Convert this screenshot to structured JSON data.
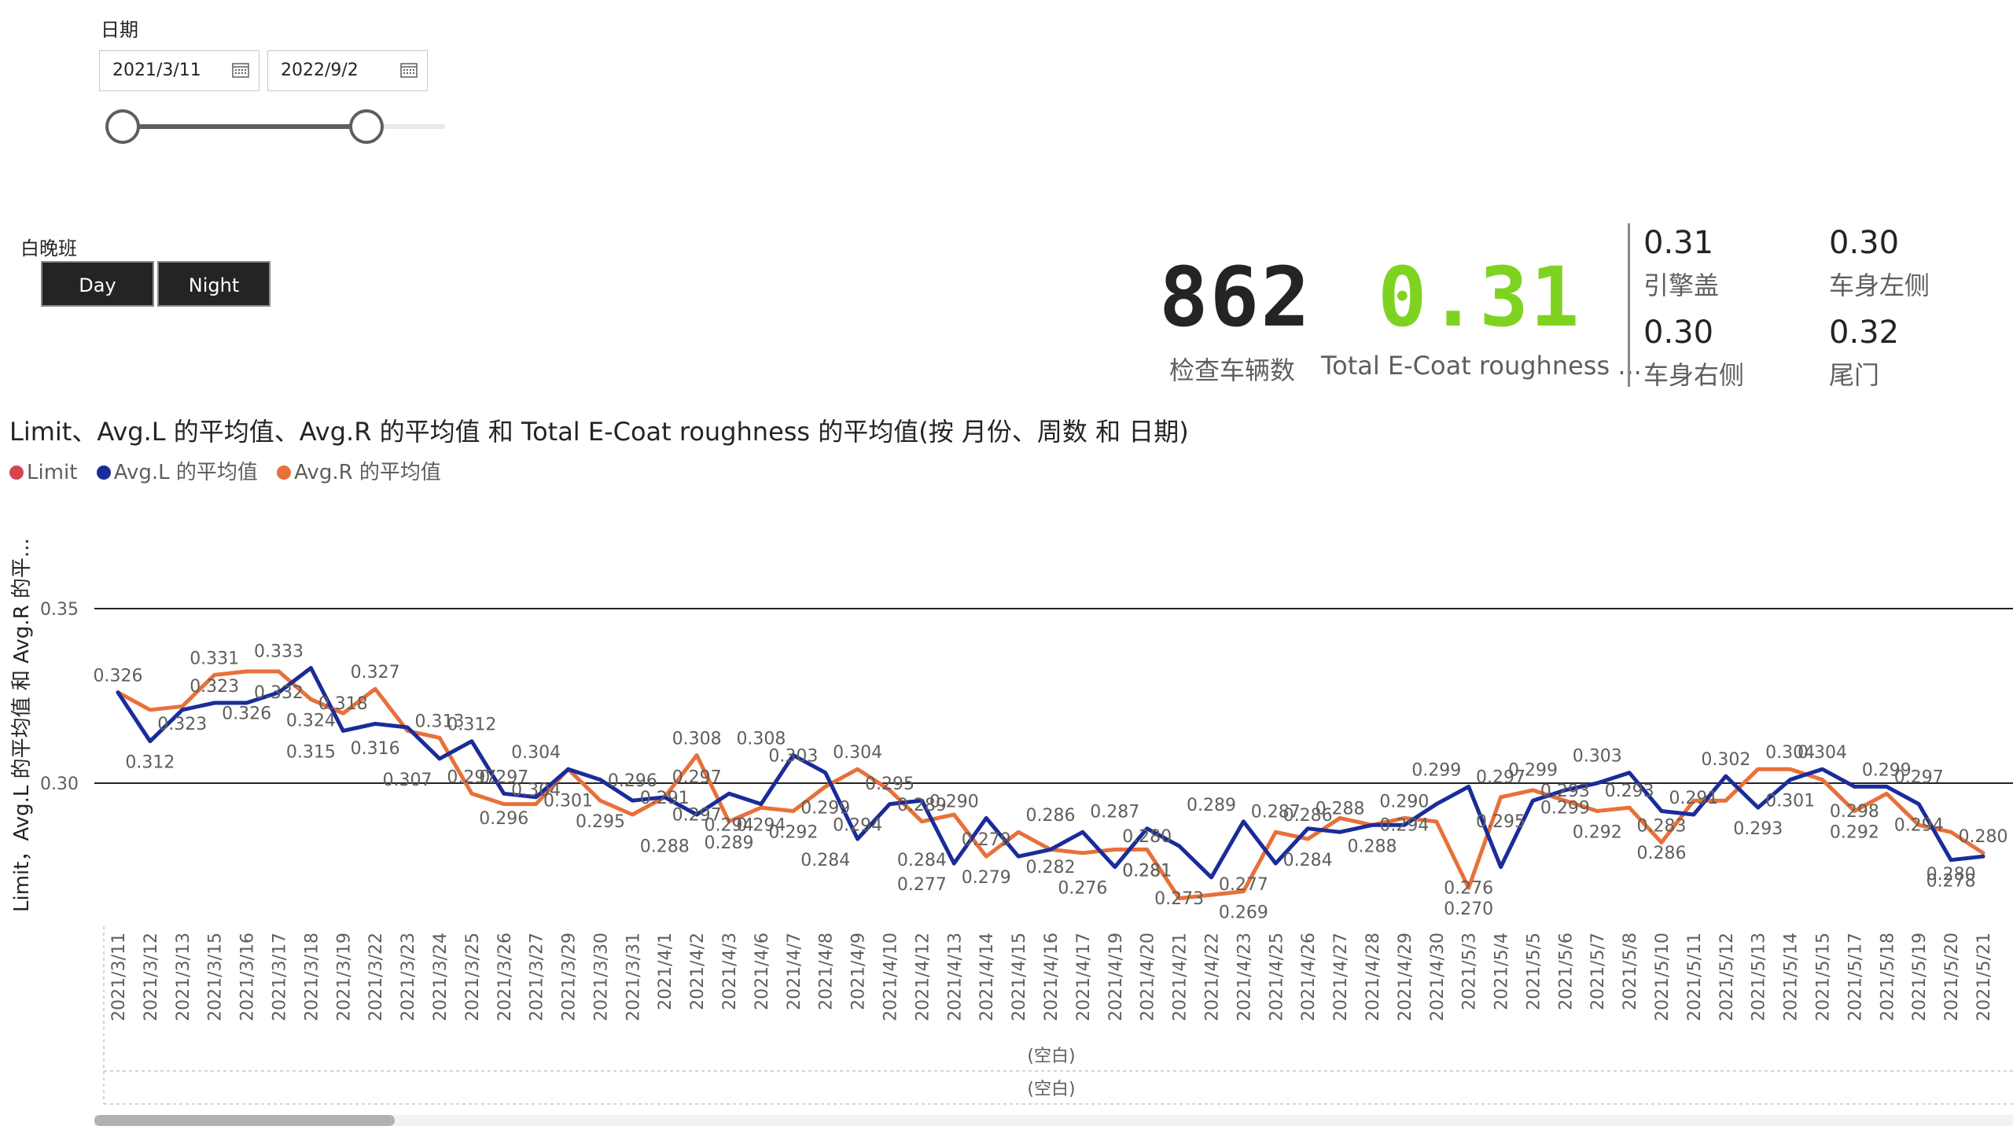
{
  "date_slicer": {
    "title": "日期",
    "start": "2021/3/11",
    "end": "2022/9/2",
    "icon": "calendar-icon"
  },
  "shift_slicer": {
    "title": "白晚班",
    "options": [
      "Day",
      "Night"
    ]
  },
  "kpis": {
    "vehicles_value": "862",
    "vehicles_label": "检查车辆数",
    "roughness_value": "0.31",
    "roughness_label": "Total E-Coat roughness ...",
    "roughness_color": "#7ed321",
    "parts": [
      {
        "value": "0.31",
        "label": "引擎盖"
      },
      {
        "value": "0.30",
        "label": "车身左侧"
      },
      {
        "value": "0.30",
        "label": "车身右侧"
      },
      {
        "value": "0.32",
        "label": "尾门"
      }
    ]
  },
  "chart_data": {
    "type": "line",
    "title": "Limit、Avg.L 的平均值、Avg.R 的平均值 和 Total E-Coat roughness 的平均值(按 月份、周数 和 日期)",
    "ylabel": "Limit，Avg.L 的平均值 和 Avg.R 的平...",
    "ylim": [
      0.24,
      0.37
    ],
    "yticks": [
      0.3,
      0.35
    ],
    "ytick_labels": [
      "0.30",
      "0.35"
    ],
    "gridlines": [
      0.3,
      0.35
    ],
    "group_labels": [
      "(空白)",
      "(空白)"
    ],
    "legend": [
      {
        "name": "Limit",
        "color": "#d64550"
      },
      {
        "name": "Avg.L 的平均值",
        "color": "#1a2c99"
      },
      {
        "name": "Avg.R 的平均值",
        "color": "#e8703a"
      }
    ],
    "categories": [
      "2021/3/11",
      "2021/3/12",
      "2021/3/13",
      "2021/3/15",
      "2021/3/16",
      "2021/3/17",
      "2021/3/18",
      "2021/3/19",
      "2021/3/22",
      "2021/3/23",
      "2021/3/24",
      "2021/3/25",
      "2021/3/26",
      "2021/3/27",
      "2021/3/29",
      "2021/3/30",
      "2021/3/31",
      "2021/4/1",
      "2021/4/2",
      "2021/4/3",
      "2021/4/6",
      "2021/4/7",
      "2021/4/8",
      "2021/4/9",
      "2021/4/10",
      "2021/4/12",
      "2021/4/13",
      "2021/4/14",
      "2021/4/15",
      "2021/4/16",
      "2021/4/17",
      "2021/4/19",
      "2021/4/20",
      "2021/4/21",
      "2021/4/22",
      "2021/4/23",
      "2021/4/25",
      "2021/4/26",
      "2021/4/27",
      "2021/4/28",
      "2021/4/29",
      "2021/4/30",
      "2021/5/3",
      "2021/5/4",
      "2021/5/5",
      "2021/5/6",
      "2021/5/7",
      "2021/5/8",
      "2021/5/10",
      "2021/5/11",
      "2021/5/12",
      "2021/5/13",
      "2021/5/14",
      "2021/5/15",
      "2021/5/17",
      "2021/5/18",
      "2021/5/19",
      "2021/5/20",
      "2021/5/21"
    ],
    "series": [
      {
        "name": "Avg.L 的平均值",
        "color": "#1a2c99",
        "values": [
          0.326,
          0.312,
          0.321,
          0.323,
          0.323,
          0.326,
          0.333,
          0.315,
          0.317,
          0.316,
          0.307,
          0.312,
          0.297,
          0.296,
          0.304,
          0.301,
          0.295,
          0.296,
          0.291,
          0.297,
          0.294,
          0.308,
          0.303,
          0.284,
          0.294,
          0.295,
          0.277,
          0.29,
          0.279,
          0.281,
          0.286,
          0.276,
          0.287,
          0.282,
          0.273,
          0.289,
          0.277,
          0.287,
          0.286,
          0.288,
          0.288,
          0.294,
          0.299,
          0.276,
          0.295,
          0.298,
          0.3,
          0.303,
          0.292,
          0.291,
          0.302,
          0.293,
          0.301,
          0.304,
          0.299,
          0.299,
          0.294,
          0.278,
          0.279
        ]
      },
      {
        "name": "Avg.R 的平均值",
        "color": "#e8703a",
        "values": [
          0.326,
          0.321,
          0.322,
          0.331,
          0.332,
          0.332,
          0.324,
          0.32,
          0.327,
          0.315,
          0.313,
          0.297,
          0.294,
          0.294,
          0.304,
          0.295,
          0.291,
          0.296,
          0.308,
          0.289,
          0.293,
          0.292,
          0.299,
          0.304,
          0.298,
          0.289,
          0.291,
          0.279,
          0.286,
          0.281,
          0.28,
          0.281,
          0.281,
          0.267,
          0.268,
          0.269,
          0.286,
          0.284,
          0.29,
          0.288,
          0.29,
          0.289,
          0.27,
          0.296,
          0.298,
          0.295,
          0.292,
          0.293,
          0.283,
          0.295,
          0.295,
          0.304,
          0.304,
          0.301,
          0.292,
          0.297,
          0.288,
          0.286,
          0.28
        ]
      }
    ],
    "data_labels": [
      {
        "text": "0.326",
        "i": 0,
        "v": 0.326,
        "pos": "above"
      },
      {
        "text": "0.312",
        "i": 1,
        "v": 0.312,
        "pos": "below"
      },
      {
        "text": "0.323",
        "i": 2,
        "v": 0.323,
        "pos": "below"
      },
      {
        "text": "0.331",
        "i": 3,
        "v": 0.331,
        "pos": "above"
      },
      {
        "text": "0.323",
        "i": 3,
        "v": 0.323,
        "pos": "above"
      },
      {
        "text": "0.326",
        "i": 4,
        "v": 0.326,
        "pos": "below"
      },
      {
        "text": "0.333",
        "i": 5,
        "v": 0.333,
        "pos": "above"
      },
      {
        "text": "0.332",
        "i": 5,
        "v": 0.332,
        "pos": "below"
      },
      {
        "text": "0.324",
        "i": 6,
        "v": 0.324,
        "pos": "below"
      },
      {
        "text": "0.315",
        "i": 6,
        "v": 0.315,
        "pos": "below"
      },
      {
        "text": "0.318",
        "i": 7,
        "v": 0.318,
        "pos": "above"
      },
      {
        "text": "0.327",
        "i": 8,
        "v": 0.327,
        "pos": "above"
      },
      {
        "text": "0.316",
        "i": 8,
        "v": 0.316,
        "pos": "below"
      },
      {
        "text": "0.307",
        "i": 9,
        "v": 0.307,
        "pos": "below"
      },
      {
        "text": "0.313",
        "i": 10,
        "v": 0.313,
        "pos": "above"
      },
      {
        "text": "0.312",
        "i": 11,
        "v": 0.312,
        "pos": "above"
      },
      {
        "text": "0.297",
        "i": 11,
        "v": 0.297,
        "pos": "above"
      },
      {
        "text": "0.297",
        "i": 12,
        "v": 0.297,
        "pos": "above"
      },
      {
        "text": "0.296",
        "i": 12,
        "v": 0.296,
        "pos": "below"
      },
      {
        "text": "0.304",
        "i": 13,
        "v": 0.304,
        "pos": "above"
      },
      {
        "text": "0.304",
        "i": 13,
        "v": 0.304,
        "pos": "below"
      },
      {
        "text": "0.301",
        "i": 14,
        "v": 0.301,
        "pos": "below"
      },
      {
        "text": "0.295",
        "i": 15,
        "v": 0.295,
        "pos": "below"
      },
      {
        "text": "0.296",
        "i": 16,
        "v": 0.296,
        "pos": "above"
      },
      {
        "text": "0.291",
        "i": 17,
        "v": 0.291,
        "pos": "above"
      },
      {
        "text": "0.288",
        "i": 17,
        "v": 0.288,
        "pos": "below"
      },
      {
        "text": "0.308",
        "i": 18,
        "v": 0.308,
        "pos": "above"
      },
      {
        "text": "0.297",
        "i": 18,
        "v": 0.297,
        "pos": "above"
      },
      {
        "text": "0.297",
        "i": 18,
        "v": 0.297,
        "pos": "below"
      },
      {
        "text": "0.294",
        "i": 19,
        "v": 0.294,
        "pos": "below"
      },
      {
        "text": "0.289",
        "i": 19,
        "v": 0.289,
        "pos": "below"
      },
      {
        "text": "0.308",
        "i": 20,
        "v": 0.308,
        "pos": "above"
      },
      {
        "text": "0.294",
        "i": 20,
        "v": 0.294,
        "pos": "below"
      },
      {
        "text": "0.303",
        "i": 21,
        "v": 0.303,
        "pos": "above"
      },
      {
        "text": "0.292",
        "i": 21,
        "v": 0.292,
        "pos": "below"
      },
      {
        "text": "0.299",
        "i": 22,
        "v": 0.299,
        "pos": "below"
      },
      {
        "text": "0.284",
        "i": 22,
        "v": 0.284,
        "pos": "below"
      },
      {
        "text": "0.304",
        "i": 23,
        "v": 0.304,
        "pos": "above"
      },
      {
        "text": "0.294",
        "i": 23,
        "v": 0.294,
        "pos": "below"
      },
      {
        "text": "0.295",
        "i": 24,
        "v": 0.295,
        "pos": "above"
      },
      {
        "text": "0.289",
        "i": 25,
        "v": 0.289,
        "pos": "above"
      },
      {
        "text": "0.284",
        "i": 25,
        "v": 0.284,
        "pos": "below"
      },
      {
        "text": "0.277",
        "i": 25,
        "v": 0.277,
        "pos": "below"
      },
      {
        "text": "0.290",
        "i": 26,
        "v": 0.29,
        "pos": "above"
      },
      {
        "text": "0.279",
        "i": 27,
        "v": 0.279,
        "pos": "above"
      },
      {
        "text": "0.279",
        "i": 27,
        "v": 0.279,
        "pos": "below"
      },
      {
        "text": "0.286",
        "i": 29,
        "v": 0.286,
        "pos": "above"
      },
      {
        "text": "0.282",
        "i": 29,
        "v": 0.282,
        "pos": "below"
      },
      {
        "text": "0.276",
        "i": 30,
        "v": 0.276,
        "pos": "below"
      },
      {
        "text": "0.287",
        "i": 31,
        "v": 0.287,
        "pos": "above"
      },
      {
        "text": "0.280",
        "i": 32,
        "v": 0.28,
        "pos": "above"
      },
      {
        "text": "0.281",
        "i": 32,
        "v": 0.281,
        "pos": "below"
      },
      {
        "text": "0.281",
        "i": 32,
        "v": 0.281,
        "pos": "below"
      },
      {
        "text": "0.273",
        "i": 33,
        "v": 0.273,
        "pos": "below"
      },
      {
        "text": "0.289",
        "i": 34,
        "v": 0.289,
        "pos": "above"
      },
      {
        "text": "0.277",
        "i": 35,
        "v": 0.277,
        "pos": "below"
      },
      {
        "text": "0.269",
        "i": 35,
        "v": 0.269,
        "pos": "below"
      },
      {
        "text": "0.287",
        "i": 36,
        "v": 0.287,
        "pos": "above"
      },
      {
        "text": "0.284",
        "i": 37,
        "v": 0.284,
        "pos": "below"
      },
      {
        "text": "0.286",
        "i": 37,
        "v": 0.286,
        "pos": "above"
      },
      {
        "text": "0.288",
        "i": 38,
        "v": 0.288,
        "pos": "above"
      },
      {
        "text": "0.288",
        "i": 39,
        "v": 0.288,
        "pos": "below"
      },
      {
        "text": "0.290",
        "i": 40,
        "v": 0.29,
        "pos": "above"
      },
      {
        "text": "0.294",
        "i": 40,
        "v": 0.294,
        "pos": "below"
      },
      {
        "text": "0.299",
        "i": 41,
        "v": 0.299,
        "pos": "above"
      },
      {
        "text": "0.276",
        "i": 42,
        "v": 0.276,
        "pos": "below"
      },
      {
        "text": "0.270",
        "i": 42,
        "v": 0.27,
        "pos": "below"
      },
      {
        "text": "0.297",
        "i": 43,
        "v": 0.297,
        "pos": "above"
      },
      {
        "text": "0.295",
        "i": 43,
        "v": 0.295,
        "pos": "below"
      },
      {
        "text": "0.299",
        "i": 44,
        "v": 0.299,
        "pos": "above"
      },
      {
        "text": "0.293",
        "i": 45,
        "v": 0.293,
        "pos": "above"
      },
      {
        "text": "0.299",
        "i": 45,
        "v": 0.299,
        "pos": "below"
      },
      {
        "text": "0.303",
        "i": 46,
        "v": 0.303,
        "pos": "above"
      },
      {
        "text": "0.292",
        "i": 46,
        "v": 0.292,
        "pos": "below"
      },
      {
        "text": "0.293",
        "i": 47,
        "v": 0.293,
        "pos": "above"
      },
      {
        "text": "0.283",
        "i": 48,
        "v": 0.283,
        "pos": "above"
      },
      {
        "text": "0.286",
        "i": 48,
        "v": 0.286,
        "pos": "below"
      },
      {
        "text": "0.291",
        "i": 49,
        "v": 0.291,
        "pos": "above"
      },
      {
        "text": "0.302",
        "i": 50,
        "v": 0.302,
        "pos": "above"
      },
      {
        "text": "0.293",
        "i": 51,
        "v": 0.293,
        "pos": "below"
      },
      {
        "text": "0.304",
        "i": 52,
        "v": 0.304,
        "pos": "above"
      },
      {
        "text": "0.301",
        "i": 52,
        "v": 0.301,
        "pos": "below"
      },
      {
        "text": "0.304",
        "i": 53,
        "v": 0.304,
        "pos": "above"
      },
      {
        "text": "0.298",
        "i": 54,
        "v": 0.298,
        "pos": "below"
      },
      {
        "text": "0.292",
        "i": 54,
        "v": 0.292,
        "pos": "below"
      },
      {
        "text": "0.299",
        "i": 55,
        "v": 0.299,
        "pos": "above"
      },
      {
        "text": "0.297",
        "i": 56,
        "v": 0.297,
        "pos": "above"
      },
      {
        "text": "0.294",
        "i": 56,
        "v": 0.294,
        "pos": "below"
      },
      {
        "text": "0.280",
        "i": 57,
        "v": 0.28,
        "pos": "below"
      },
      {
        "text": "0.278",
        "i": 57,
        "v": 0.278,
        "pos": "below"
      },
      {
        "text": "0.280",
        "i": 58,
        "v": 0.28,
        "pos": "above"
      }
    ]
  }
}
